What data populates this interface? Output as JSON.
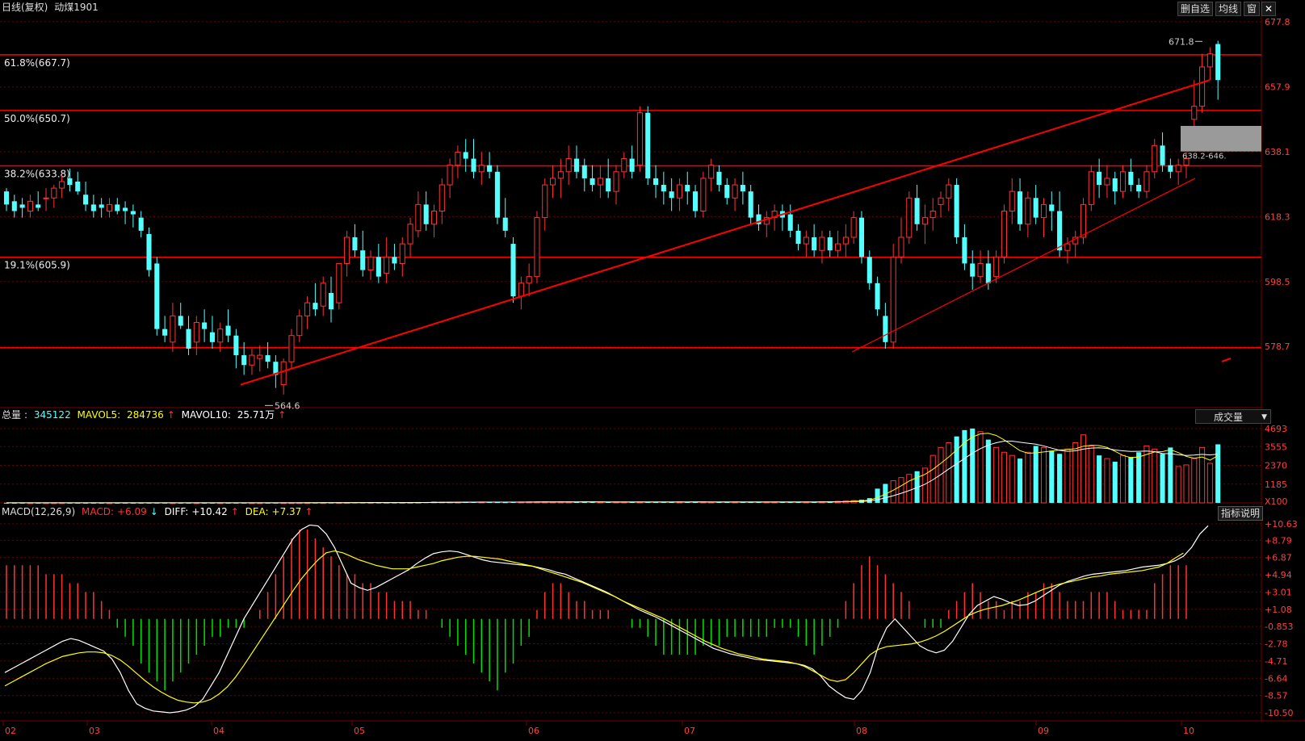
{
  "header": {
    "period": "日线(复权)",
    "symbol": "动煤1901"
  },
  "toolbar": {
    "buttons": [
      "删自选",
      "均线",
      "窗"
    ],
    "close_icon": "close-icon"
  },
  "price_axis_labels": [
    "677.8",
    "657.9",
    "638.1",
    "618.3",
    "598.5",
    "578.7"
  ],
  "fib_levels": [
    {
      "label": "61.8%(667.7)",
      "value": 667.7
    },
    {
      "label": "50.0%(650.7)",
      "value": 650.7
    },
    {
      "label": "38.2%(633.8)",
      "value": 633.8
    },
    {
      "label": "19.1%(605.9)",
      "value": 605.9
    },
    {
      "label": "",
      "value": 578.3
    }
  ],
  "annotations": {
    "high": "671.8",
    "low": "564.6",
    "gap": "638.2-646."
  },
  "volume_panel": {
    "total_label": "总量",
    "total_value": "345122",
    "ma5_label": "MAVOL5:",
    "ma5_value": "284736",
    "ma10_label": "MAVOL10:",
    "ma10_value": "25.71万",
    "dropdown_label": "成交量",
    "axis_labels": [
      "4693",
      "3555",
      "2370",
      "1185",
      "X100"
    ]
  },
  "macd_panel": {
    "title": "MACD(12,26,9)",
    "macd_label": "MACD:",
    "macd_value": "+6.09",
    "diff_label": "DIFF:",
    "diff_value": "+10.42",
    "dea_label": "DEA:",
    "dea_value": "+7.37",
    "explain_button": "指标说明",
    "axis_labels": [
      "+10.63",
      "+8.79",
      "+6.87",
      "+4.94",
      "+3.01",
      "+1.08",
      "-0.853",
      "-2.78",
      "-4.71",
      "-6.64",
      "-8.57",
      "-10.50"
    ]
  },
  "time_axis_labels": [
    "02",
    "03",
    "04",
    "05",
    "06",
    "07",
    "08",
    "09",
    "10"
  ],
  "colors": {
    "up": "#ff3232",
    "down": "#54ffff",
    "fib_line": "#ff0000",
    "grid": "#6b0000",
    "axis_text": "#ff4040",
    "white_line": "#ffffff",
    "yellow_line": "#ffff00",
    "macd_pos": "#ff3232",
    "macd_neg": "#00e000"
  },
  "chart_data": {
    "type": "candlestick",
    "y_range": [
      560,
      680
    ],
    "candles": [
      [
        626,
        627,
        620,
        622
      ],
      [
        623,
        625,
        618,
        620
      ],
      [
        622,
        624,
        618,
        621
      ],
      [
        620,
        625,
        618,
        623
      ],
      [
        622,
        626,
        620,
        621
      ],
      [
        624,
        627,
        620,
        624
      ],
      [
        624,
        628,
        621,
        627
      ],
      [
        627,
        631,
        624,
        629
      ],
      [
        630,
        633,
        626,
        628
      ],
      [
        629,
        632,
        625,
        626
      ],
      [
        625,
        629,
        620,
        622
      ],
      [
        622,
        625,
        618,
        620
      ],
      [
        622,
        624,
        618,
        621
      ],
      [
        620,
        624,
        618,
        622
      ],
      [
        622,
        624,
        619,
        620
      ],
      [
        621,
        623,
        616,
        620
      ],
      [
        620,
        622,
        615,
        619
      ],
      [
        618,
        620,
        612,
        614
      ],
      [
        613,
        615,
        600,
        602
      ],
      [
        604,
        606,
        582,
        584
      ],
      [
        584,
        588,
        580,
        582
      ],
      [
        580,
        592,
        577,
        588
      ],
      [
        588,
        592,
        584,
        585
      ],
      [
        584,
        588,
        576,
        578
      ],
      [
        580,
        588,
        576,
        586
      ],
      [
        586,
        590,
        580,
        584
      ],
      [
        583,
        588,
        578,
        580
      ],
      [
        580,
        586,
        577,
        584
      ],
      [
        585,
        590,
        580,
        582
      ],
      [
        582,
        584,
        572,
        576
      ],
      [
        576,
        580,
        570,
        573
      ],
      [
        573,
        578,
        570,
        576
      ],
      [
        575,
        579,
        571,
        576
      ],
      [
        576,
        580,
        572,
        574
      ],
      [
        574,
        576,
        566,
        570
      ],
      [
        567,
        575,
        564,
        574
      ],
      [
        574,
        584,
        572,
        582
      ],
      [
        582,
        590,
        580,
        588
      ],
      [
        588,
        594,
        584,
        592
      ],
      [
        592,
        598,
        588,
        590
      ],
      [
        591,
        600,
        588,
        598
      ],
      [
        595,
        600,
        586,
        590
      ],
      [
        592,
        604,
        590,
        604
      ],
      [
        604,
        614,
        600,
        612
      ],
      [
        612,
        616,
        606,
        608
      ],
      [
        608,
        614,
        600,
        602
      ],
      [
        602,
        608,
        599,
        606
      ],
      [
        606,
        610,
        598,
        600
      ],
      [
        601,
        612,
        598,
        606
      ],
      [
        606,
        610,
        602,
        604
      ],
      [
        604,
        612,
        600,
        610
      ],
      [
        610,
        618,
        606,
        616
      ],
      [
        614,
        626,
        612,
        622
      ],
      [
        622,
        626,
        614,
        616
      ],
      [
        616,
        622,
        612,
        620
      ],
      [
        620,
        630,
        616,
        628
      ],
      [
        628,
        636,
        624,
        634
      ],
      [
        634,
        640,
        630,
        638
      ],
      [
        638,
        642,
        632,
        636
      ],
      [
        636,
        642,
        630,
        632
      ],
      [
        632,
        638,
        628,
        634
      ],
      [
        634,
        638,
        630,
        632
      ],
      [
        632,
        634,
        616,
        618
      ],
      [
        618,
        624,
        612,
        614
      ],
      [
        610,
        612,
        592,
        594
      ],
      [
        594,
        600,
        590,
        598
      ],
      [
        598,
        604,
        594,
        600
      ],
      [
        600,
        620,
        598,
        618
      ],
      [
        618,
        630,
        614,
        628
      ],
      [
        628,
        634,
        624,
        630
      ],
      [
        630,
        636,
        624,
        632
      ],
      [
        632,
        640,
        628,
        636
      ],
      [
        636,
        640,
        630,
        632
      ],
      [
        634,
        636,
        626,
        630
      ],
      [
        630,
        634,
        626,
        628
      ],
      [
        628,
        634,
        624,
        630
      ],
      [
        630,
        636,
        624,
        626
      ],
      [
        626,
        634,
        622,
        632
      ],
      [
        632,
        638,
        630,
        636
      ],
      [
        636,
        640,
        630,
        632
      ],
      [
        634,
        652,
        632,
        650
      ],
      [
        650,
        652,
        628,
        630
      ],
      [
        630,
        634,
        624,
        628
      ],
      [
        628,
        632,
        622,
        626
      ],
      [
        626,
        630,
        620,
        624
      ],
      [
        624,
        630,
        620,
        628
      ],
      [
        628,
        632,
        622,
        626
      ],
      [
        626,
        628,
        618,
        620
      ],
      [
        620,
        632,
        618,
        630
      ],
      [
        630,
        636,
        626,
        634
      ],
      [
        632,
        634,
        626,
        628
      ],
      [
        628,
        630,
        622,
        624
      ],
      [
        624,
        630,
        620,
        628
      ],
      [
        628,
        632,
        622,
        626
      ],
      [
        626,
        628,
        616,
        618
      ],
      [
        619,
        622,
        614,
        616
      ],
      [
        616,
        620,
        612,
        618
      ],
      [
        618,
        622,
        614,
        620
      ],
      [
        620,
        622,
        614,
        618
      ],
      [
        619,
        622,
        612,
        614
      ],
      [
        614,
        616,
        608,
        610
      ],
      [
        610,
        614,
        606,
        612
      ],
      [
        612,
        616,
        606,
        608
      ],
      [
        608,
        614,
        604,
        612
      ],
      [
        612,
        614,
        606,
        608
      ],
      [
        608,
        614,
        606,
        610
      ],
      [
        610,
        616,
        606,
        612
      ],
      [
        612,
        620,
        610,
        618
      ],
      [
        618,
        620,
        604,
        606
      ],
      [
        606,
        608,
        596,
        598
      ],
      [
        598,
        600,
        588,
        590
      ],
      [
        588,
        592,
        578,
        580
      ],
      [
        580,
        610,
        578,
        606
      ],
      [
        606,
        618,
        604,
        612
      ],
      [
        612,
        626,
        610,
        624
      ],
      [
        624,
        628,
        614,
        616
      ],
      [
        616,
        622,
        610,
        618
      ],
      [
        618,
        624,
        614,
        620
      ],
      [
        622,
        626,
        618,
        624
      ],
      [
        624,
        630,
        620,
        628
      ],
      [
        628,
        630,
        610,
        612
      ],
      [
        612,
        616,
        602,
        604
      ],
      [
        604,
        608,
        596,
        600
      ],
      [
        600,
        608,
        598,
        604
      ],
      [
        604,
        608,
        596,
        598
      ],
      [
        600,
        608,
        598,
        606
      ],
      [
        606,
        622,
        604,
        620
      ],
      [
        620,
        630,
        616,
        626
      ],
      [
        626,
        630,
        614,
        616
      ],
      [
        616,
        626,
        612,
        624
      ],
      [
        624,
        628,
        616,
        618
      ],
      [
        618,
        624,
        612,
        622
      ],
      [
        622,
        626,
        614,
        620
      ],
      [
        620,
        626,
        606,
        608
      ],
      [
        608,
        612,
        604,
        610
      ],
      [
        610,
        614,
        606,
        612
      ],
      [
        612,
        624,
        610,
        622
      ],
      [
        622,
        634,
        620,
        632
      ],
      [
        632,
        636,
        624,
        628
      ],
      [
        628,
        634,
        624,
        630
      ],
      [
        630,
        632,
        622,
        626
      ],
      [
        626,
        634,
        624,
        632
      ],
      [
        632,
        636,
        626,
        628
      ],
      [
        628,
        630,
        624,
        626
      ],
      [
        626,
        634,
        624,
        632
      ],
      [
        632,
        642,
        630,
        640
      ],
      [
        640,
        644,
        632,
        634
      ],
      [
        634,
        636,
        630,
        632
      ],
      [
        632,
        636,
        628,
        634
      ],
      [
        634,
        638,
        630,
        636
      ],
      [
        648,
        660,
        646,
        652
      ],
      [
        652,
        668,
        650,
        664
      ],
      [
        664,
        670,
        660,
        668
      ],
      [
        671,
        672,
        654,
        660
      ]
    ],
    "volumes": [
      5,
      5,
      6,
      5,
      5,
      6,
      6,
      7,
      6,
      5,
      5,
      6,
      5,
      6,
      5,
      6,
      5,
      6,
      7,
      8,
      7,
      6,
      6,
      7,
      6,
      5,
      6,
      7,
      6,
      7,
      8,
      7,
      6,
      7,
      8,
      9,
      10,
      12,
      11,
      13,
      14,
      15,
      16,
      20,
      22,
      20,
      18,
      19,
      21,
      20,
      22,
      25,
      30,
      40,
      60,
      50,
      45,
      40,
      50,
      55,
      60,
      50,
      45,
      40,
      55,
      60,
      70,
      65,
      60,
      55,
      60,
      65,
      70,
      60,
      55,
      50,
      55,
      60,
      58,
      62,
      60,
      55,
      50,
      55,
      60,
      65,
      70,
      60,
      55,
      50,
      55,
      60,
      58,
      52,
      55,
      60,
      58,
      55,
      60,
      62,
      60,
      58,
      60,
      65,
      80,
      100,
      120,
      150,
      200,
      300,
      900,
      1200,
      1400,
      1600,
      1800,
      2000,
      2200,
      3000,
      3500,
      3800,
      4200,
      4600,
      4700,
      4500,
      4000,
      3500,
      3200,
      3000,
      2800,
      3200,
      3600,
      3500,
      3300,
      3100,
      3400,
      3800,
      4300,
      3600,
      3000,
      2800,
      2600,
      3000,
      2900,
      3200,
      3600,
      3400,
      3100,
      3500,
      2300,
      2400,
      2800,
      3500,
      2500,
      3700
    ],
    "macd_hist": [
      6,
      6,
      6,
      6,
      6,
      5,
      5,
      5,
      4,
      4,
      3,
      3,
      2,
      1,
      -1,
      -2,
      -3,
      -5,
      -6,
      -7,
      -8,
      -7,
      -6,
      -5,
      -4,
      -3,
      -2,
      -2,
      -1,
      -1,
      -1,
      0,
      1,
      3,
      5,
      7,
      9,
      10,
      10,
      9,
      8,
      7,
      6,
      5,
      5,
      4,
      4,
      3,
      3,
      2,
      2,
      2,
      1,
      1,
      0,
      -1,
      -2,
      -3,
      -4,
      -5,
      -6,
      -7,
      -8,
      -6,
      -5,
      -3,
      -2,
      1,
      3,
      4,
      4,
      3,
      2,
      2,
      1,
      1,
      1,
      0,
      0,
      -1,
      -1,
      -2,
      -3,
      -4,
      -4,
      -4,
      -4,
      -4,
      -3,
      -3,
      -3,
      -2,
      -2,
      -2,
      -2,
      -2,
      -2,
      -1,
      -1,
      -1,
      -2,
      -3,
      -4,
      -3,
      -2,
      -1,
      2,
      4,
      6,
      7,
      6,
      5,
      4,
      3,
      2,
      0,
      -1,
      -1,
      -1,
      1,
      2,
      3,
      4,
      3,
      2,
      2,
      1,
      2,
      2,
      3,
      3,
      4,
      4,
      3,
      2,
      2,
      2,
      3,
      3,
      3,
      2,
      1,
      1,
      1,
      1,
      4,
      5,
      6,
      6,
      6
    ],
    "macd_diff": [
      -6,
      -5.5,
      -5,
      -4.5,
      -4,
      -3.5,
      -3,
      -2.5,
      -2.2,
      -2.4,
      -2.8,
      -3.2,
      -3.6,
      -4.5,
      -6,
      -8,
      -9.5,
      -10,
      -10.3,
      -10.4,
      -10.5,
      -10.4,
      -10.2,
      -9.8,
      -9,
      -7.5,
      -6,
      -4,
      -2,
      0,
      1.5,
      3,
      4.5,
      6,
      7.5,
      9,
      10,
      10.5,
      10.4,
      9.5,
      8,
      6,
      4,
      3.5,
      3.2,
      3.5,
      4,
      4.5,
      5,
      5.5,
      6.2,
      6.8,
      7.3,
      7.5,
      7.6,
      7.5,
      7.2,
      6.9,
      6.6,
      6.4,
      6.3,
      6.2,
      6.1,
      6,
      5.9,
      5.7,
      5.5,
      5.2,
      5,
      4.6,
      4.2,
      3.8,
      3.4,
      3,
      2.5,
      2,
      1.5,
      1,
      0.6,
      0.2,
      -0.3,
      -0.8,
      -1.3,
      -1.8,
      -2.3,
      -2.8,
      -3.3,
      -3.6,
      -3.9,
      -4.1,
      -4.3,
      -4.5,
      -4.6,
      -4.7,
      -4.8,
      -4.9,
      -5,
      -5.2,
      -5.6,
      -6.4,
      -7.5,
      -8.2,
      -8.8,
      -9,
      -8,
      -6,
      -3,
      -1,
      0,
      -1,
      -2,
      -3,
      -3.5,
      -3.8,
      -3.5,
      -2.5,
      -1,
      0.5,
      1.5,
      2,
      2.5,
      2.2,
      1.8,
      1.5,
      1.6,
      2,
      2.6,
      3.2,
      3.8,
      4.2,
      4.5,
      4.8,
      5,
      5.1,
      5.2,
      5.3,
      5.4,
      5.6,
      5.8,
      5.9,
      6,
      6.2,
      6.5,
      7,
      8,
      9.5,
      10.42
    ],
    "macd_dea": [
      -7.5,
      -7,
      -6.5,
      -6,
      -5.5,
      -5,
      -4.6,
      -4.2,
      -4,
      -3.8,
      -3.7,
      -3.7,
      -3.8,
      -4.1,
      -4.6,
      -5.3,
      -6.1,
      -6.9,
      -7.6,
      -8.2,
      -8.7,
      -9.1,
      -9.3,
      -9.4,
      -9.3,
      -9,
      -8.4,
      -7.6,
      -6.5,
      -5.2,
      -3.8,
      -2.4,
      -1,
      0.4,
      1.8,
      3.2,
      4.5,
      5.6,
      6.6,
      7.4,
      7.6,
      7.4,
      7,
      6.6,
      6.3,
      6,
      5.8,
      5.6,
      5.6,
      5.6,
      5.8,
      6,
      6.2,
      6.5,
      6.7,
      6.9,
      7,
      7,
      6.9,
      6.8,
      6.7,
      6.5,
      6.3,
      6.1,
      5.9,
      5.6,
      5.3,
      5,
      4.7,
      4.4,
      4.1,
      3.7,
      3.3,
      2.9,
      2.5,
      2,
      1.6,
      1.2,
      0.8,
      0.4,
      0,
      -0.5,
      -1,
      -1.5,
      -2,
      -2.5,
      -2.9,
      -3.3,
      -3.6,
      -3.9,
      -4.1,
      -4.3,
      -4.5,
      -4.6,
      -4.7,
      -4.8,
      -5,
      -5.3,
      -5.8,
      -6.3,
      -6.8,
      -7,
      -6.8,
      -6,
      -5,
      -4,
      -3.4,
      -3.1,
      -3,
      -2.9,
      -2.8,
      -2.6,
      -2.3,
      -1.9,
      -1.4,
      -0.8,
      -0.2,
      0.4,
      0.8,
      1.1,
      1.3,
      1.5,
      1.8,
      2.1,
      2.5,
      2.9,
      3.3,
      3.6,
      3.9,
      4.1,
      4.3,
      4.5,
      4.7,
      4.8,
      5,
      5.1,
      5.2,
      5.3,
      5.4,
      5.6,
      5.8,
      6.2,
      6.8,
      7.37
    ]
  }
}
